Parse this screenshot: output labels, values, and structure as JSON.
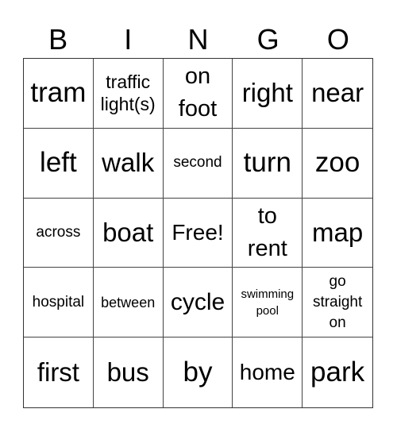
{
  "header": {
    "letters": [
      "B",
      "I",
      "N",
      "G",
      "O"
    ]
  },
  "grid": {
    "cells": [
      [
        "tram",
        "traffic light(s)",
        "on foot",
        "right",
        "near"
      ],
      [
        "left",
        "walk",
        "second",
        "turn",
        "zoo"
      ],
      [
        "across",
        "boat",
        "Free!",
        "to rent",
        "map"
      ],
      [
        "hospital",
        "between",
        "cycle",
        "swimming pool",
        "go straight on"
      ],
      [
        "first",
        "bus",
        "by",
        "home",
        "park"
      ]
    ],
    "free_space": "Free!"
  }
}
